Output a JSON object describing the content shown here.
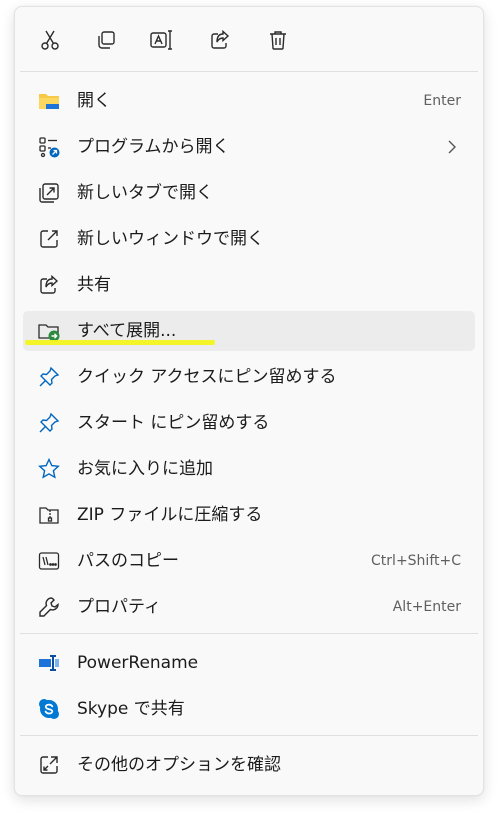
{
  "toolbar": {
    "buttons": [
      {
        "icon": "cut-icon"
      },
      {
        "icon": "copy-icon"
      },
      {
        "icon": "rename-icon"
      },
      {
        "icon": "share-icon"
      },
      {
        "icon": "delete-icon"
      }
    ]
  },
  "menu": {
    "items": [
      {
        "label": "開く",
        "shortcut": "Enter",
        "icon": "folder-icon"
      },
      {
        "label": "プログラムから開く",
        "icon": "open-with-icon",
        "submenu": true
      },
      {
        "label": "新しいタブで開く",
        "icon": "new-tab-icon"
      },
      {
        "label": "新しいウィンドウで開く",
        "icon": "new-window-icon"
      },
      {
        "label": "共有",
        "icon": "share-icon"
      },
      {
        "label": "すべて展開...",
        "icon": "extract-folder-icon",
        "highlighted": true
      },
      {
        "label": "クイック アクセスにピン留めする",
        "icon": "pin-icon"
      },
      {
        "label": "スタート にピン留めする",
        "icon": "pin-icon"
      },
      {
        "label": "お気に入りに追加",
        "icon": "star-icon"
      },
      {
        "label": "ZIP ファイルに圧縮する",
        "icon": "zip-icon"
      },
      {
        "label": "パスのコピー",
        "shortcut": "Ctrl+Shift+C",
        "icon": "copy-path-icon"
      },
      {
        "label": "プロパティ",
        "shortcut": "Alt+Enter",
        "icon": "wrench-icon"
      },
      {
        "label": "PowerRename",
        "icon": "powerrename-icon"
      },
      {
        "label": "Skype で共有",
        "icon": "skype-icon"
      },
      {
        "label": "その他のオプションを確認",
        "icon": "more-options-icon"
      }
    ]
  },
  "colors": {
    "accent": "#0067c0",
    "folder": "#f7c948",
    "highlight_marker": "#f3f61e",
    "skype": "#0078d4"
  }
}
